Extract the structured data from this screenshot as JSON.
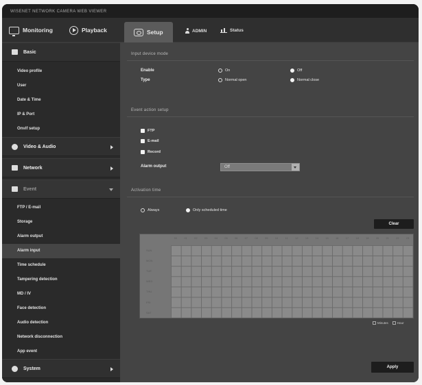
{
  "app": {
    "title": "WISENET NETWORK CAMERA WEB VIEWER"
  },
  "nav": {
    "monitoring": "Monitoring",
    "playback": "Playback",
    "setup": "Setup",
    "user": "ADMIN",
    "status": "Status"
  },
  "sidebar": {
    "basic": "Basic",
    "basic_items": [
      "Video profile",
      "User",
      "Date & Time",
      "IP & Port",
      "Onvif setup"
    ],
    "video_audio": "Video & Audio",
    "network": "Network",
    "event": "Event",
    "event_items": [
      "FTP / E-mail",
      "Storage",
      "Alarm output",
      "Alarm input",
      "Time schedule",
      "Tampering detection",
      "MD / IV",
      "Face detection",
      "Audio detection",
      "Network disconnection",
      "App event"
    ],
    "selected_item": "Alarm input",
    "system": "System"
  },
  "content": {
    "input_section": "Input device mode",
    "enable_label": "Enable",
    "enable_on": "On",
    "enable_off": "Off",
    "type_label": "Type",
    "type_no": "Normal open",
    "type_nc": "Normal close",
    "action_section": "Event action setup",
    "ftp": "FTP",
    "email": "E-mail",
    "record": "Record",
    "alarm_output_label": "Alarm output",
    "alarm_output_value": "Off",
    "activation_section": "Activation time",
    "always": "Always",
    "only_scheduled": "Only scheduled time",
    "clear_button": "Clear",
    "hours": [
      "00",
      "01",
      "02",
      "03",
      "04",
      "05",
      "06",
      "07",
      "08",
      "09",
      "10",
      "11",
      "12",
      "13",
      "14",
      "15",
      "16",
      "17",
      "18",
      "19",
      "20",
      "21",
      "22",
      "23"
    ],
    "days": [
      "SUN",
      "MON",
      "TUE",
      "WED",
      "THU",
      "FRI",
      "SAT"
    ],
    "legend_minutes": "Minutes",
    "legend_hour": "Hour",
    "apply_button": "Apply"
  },
  "state": {
    "enable": "Off",
    "type": "Normal close",
    "activation": "Only scheduled time"
  }
}
